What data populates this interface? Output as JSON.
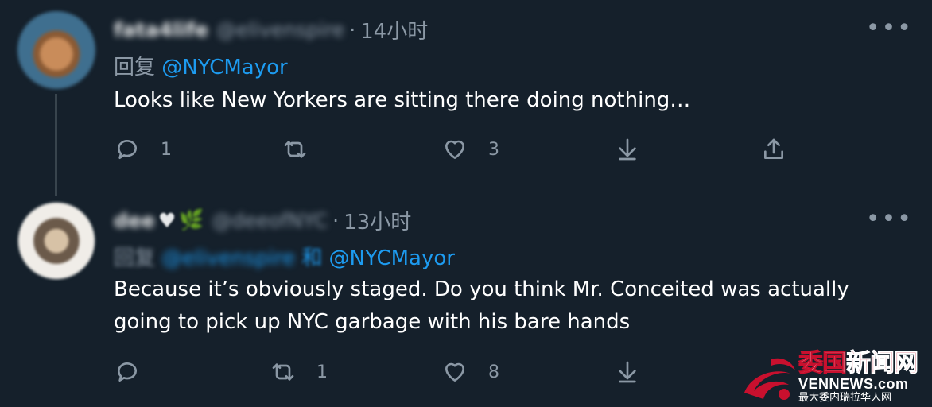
{
  "tweets": [
    {
      "author_name": "fata4life",
      "handle": "@elivenspire",
      "dot": "·",
      "time": "14小时",
      "reply_prefix": "回复",
      "reply_to": [
        "@NYCMayor"
      ],
      "reply_join": "",
      "text": "Looks like New Yorkers are sitting there doing nothing…",
      "actions": {
        "reply_count": "1",
        "retweet_count": "",
        "like_count": "3"
      },
      "more": "•••"
    },
    {
      "author_name": "dee",
      "author_emoji": [
        "♥",
        "🌿"
      ],
      "handle": "@deeofNYC",
      "dot": "·",
      "time": "13小时",
      "reply_prefix": "回复",
      "reply_to": [
        "@elivenspire",
        "@NYCMayor"
      ],
      "reply_join": "和",
      "text_lines": [
        "Because it’s obviously staged. Do you think Mr. Conceited was actually",
        "going to pick up NYC garbage with his bare hands"
      ],
      "actions": {
        "reply_count": "",
        "retweet_count": "1",
        "like_count": "8"
      },
      "more": "•••"
    }
  ],
  "icons": {
    "reply": "reply-icon",
    "retweet": "retweet-icon",
    "like": "like-icon",
    "download": "download-icon",
    "share": "share-icon",
    "more": "more-icon"
  },
  "colors": {
    "background": "#15202b",
    "secondary_text": "#8b98a5",
    "link": "#1d9bf0",
    "watermark_red": "#c8102e"
  },
  "watermark": {
    "title_white": "委国",
    "title_red": "新闻网",
    "url": "VENNEWS.com",
    "subtitle": "最大委内瑞拉华人网"
  }
}
